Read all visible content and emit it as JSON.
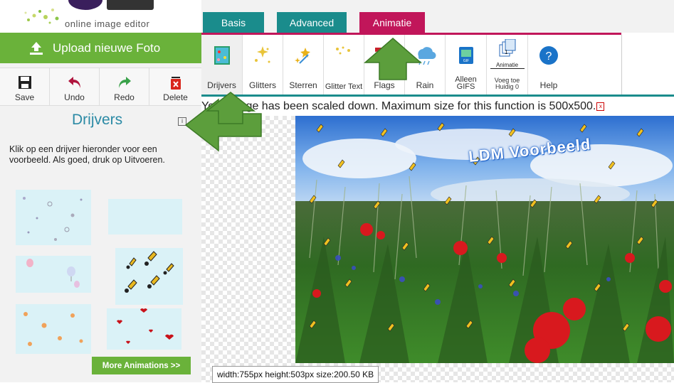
{
  "logo": {
    "tagline": "online image editor"
  },
  "upload": {
    "label": "Upload nieuwe Foto"
  },
  "toolbar": {
    "save": "Save",
    "undo": "Undo",
    "redo": "Redo",
    "delete": "Delete"
  },
  "panel": {
    "title": "Drijvers",
    "info_icon": "i",
    "description": "Klik op een drijver hieronder voor een voorbeeld. Als goed, druk op Uitvoeren.",
    "more_button": "More Animations >>"
  },
  "tabs": {
    "basis": "Basis",
    "advanced": "Advanced",
    "animatie": "Animatie"
  },
  "anim_tools": {
    "drijvers": "Drijvers",
    "glitters": "Glitters",
    "sterren": "Sterren",
    "glitter_text": "Glitter Text",
    "flags": "Flags",
    "rain": "Rain",
    "alleen_gifs": "Alleen GIFS",
    "animatie_icon_text": "Animatie",
    "voeg_toe": "Voeg toe Huidig 0",
    "help": "Help"
  },
  "notice": {
    "text": "Your image has been scaled down. Maximum size for this function is 500x500."
  },
  "image": {
    "overlay_text": "LDM Voorbeeld"
  },
  "dims": {
    "text": "width:755px  height:503px  size:200.50 KB"
  },
  "colors": {
    "teal": "#1a8c8c",
    "magenta": "#c1165a",
    "green": "#6ab23a",
    "title_blue": "#2b8aa5"
  }
}
